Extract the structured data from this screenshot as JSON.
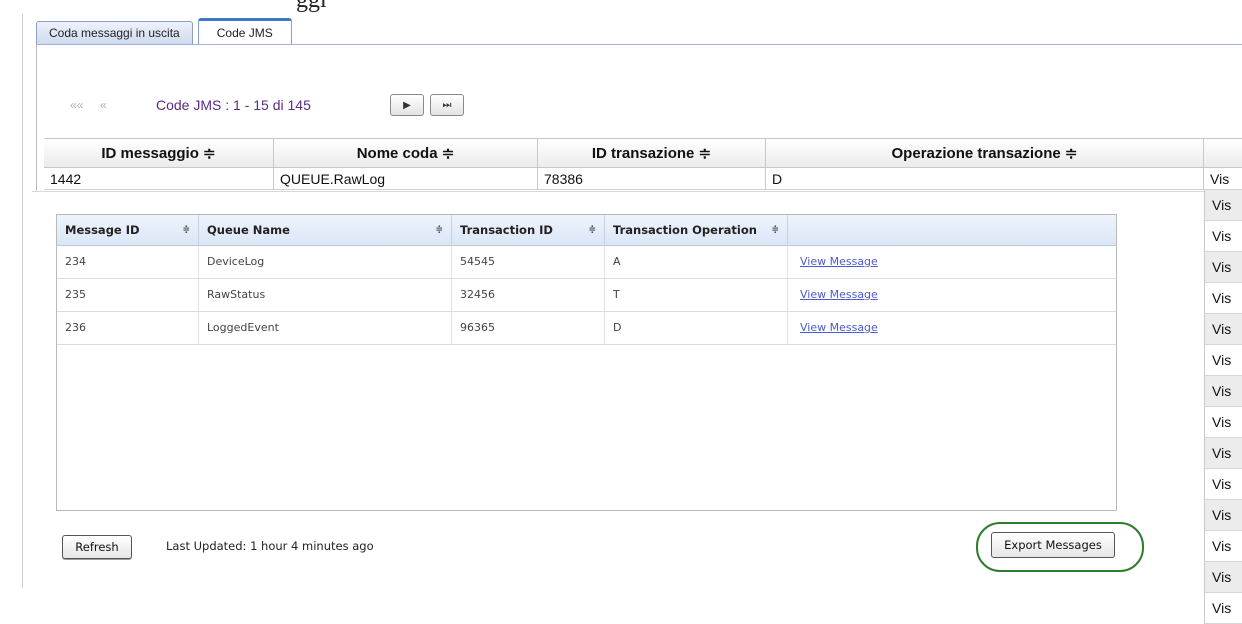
{
  "top_partial_text": "ggi",
  "tabs": [
    {
      "label": "Coda messaggi in uscita",
      "active": false
    },
    {
      "label": "Code JMS",
      "active": true
    }
  ],
  "pager": {
    "first_label": "««",
    "prev_label": "«",
    "range_label": "Code JMS : 1 - 15 di 145",
    "next_icon": "next-icon",
    "last_icon": "last-page-icon"
  },
  "bg_table": {
    "columns": [
      "ID messaggio ≑",
      "Nome coda ≑",
      "ID transazione ≑",
      "Operazione transazione ≑",
      ""
    ],
    "first_row": [
      "1442",
      "QUEUE.RawLog",
      "78386",
      "D",
      "Vis"
    ],
    "right_column_cells": [
      "Vis",
      "Vis",
      "Vis",
      "Vis",
      "Vis",
      "Vis",
      "Vis",
      "Vis",
      "Vis",
      "Vis",
      "Vis",
      "Vis",
      "Vis",
      "Vis"
    ]
  },
  "dialog": {
    "columns": [
      "Message ID",
      "Queue Name",
      "Transaction ID",
      "Transaction Operation",
      ""
    ],
    "sort_glyph": "≑",
    "rows": [
      {
        "id": "234",
        "queue": "DeviceLog",
        "txn": "54545",
        "op": "A",
        "action": "View Message"
      },
      {
        "id": "235",
        "queue": "RawStatus",
        "txn": "32456",
        "op": "T",
        "action": "View Message"
      },
      {
        "id": "236",
        "queue": "LoggedEvent",
        "txn": "96365",
        "op": "D",
        "action": "View Message"
      }
    ],
    "refresh_label": "Refresh",
    "last_updated": "Last Updated:  1 hour 4 minutes ago",
    "export_label": "Export Messages",
    "highlight_color": "#2e7d2e",
    "link_color": "#4b5bd0"
  }
}
